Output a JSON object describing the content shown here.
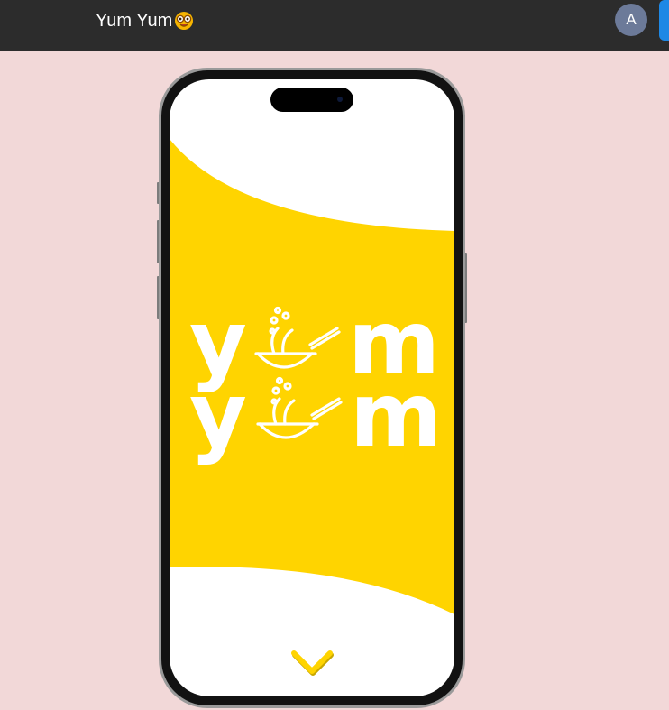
{
  "header": {
    "title": "Yum Yum",
    "title_emoji": "nerd-face-emoji",
    "avatar_initial": "A"
  },
  "phone": {
    "logo_text_line1": "yum",
    "logo_text_line2": "yum",
    "scroll_icon": "chevron-down-icon"
  },
  "colors": {
    "page_background": "#f2d8d8",
    "topbar": "#2c2c2c",
    "brand_yellow": "#ffd400",
    "avatar": "#6c7a99",
    "edge_button": "#1e88e5"
  }
}
